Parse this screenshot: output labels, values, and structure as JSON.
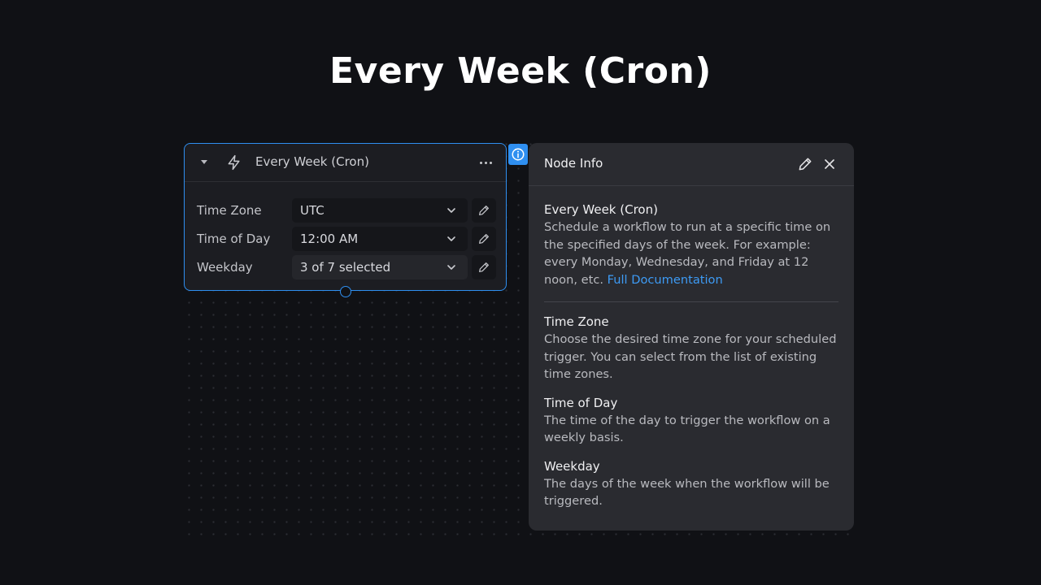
{
  "page": {
    "title": "Every Week (Cron)"
  },
  "node": {
    "title": "Every Week (Cron)",
    "fields": [
      {
        "label": "Time Zone",
        "value": "UTC"
      },
      {
        "label": "Time of Day",
        "value": "12:00 AM"
      },
      {
        "label": "Weekday",
        "value": "3 of 7 selected"
      }
    ]
  },
  "panel": {
    "title": "Node Info",
    "intro": {
      "heading": "Every Week (Cron)",
      "text": "Schedule a workflow to run at a specific time on the specified days of the week. For example: every Monday, Wednesday, and Friday at 12 noon, etc.",
      "link": "Full Documentation"
    },
    "sections": [
      {
        "heading": "Time Zone",
        "text": "Choose the desired time zone for your scheduled trigger. You can select from the list of existing time zones."
      },
      {
        "heading": "Time of Day",
        "text": "The time of the day to trigger the workflow on a weekly basis."
      },
      {
        "heading": "Weekday",
        "text": "The days of the week when the workflow will be triggered."
      }
    ]
  },
  "icons": {
    "collapse": "caret-down-icon",
    "trigger": "lightning-bolt-icon",
    "menu": "more-horizontal-icon",
    "edit": "pencil-icon",
    "dropdown": "chevron-down-icon",
    "info": "info-icon",
    "close": "close-icon"
  },
  "colors": {
    "accent": "#2f8ff0",
    "background": "#101115",
    "node_bg": "#1c1d22",
    "panel_bg": "#2a2b30",
    "link": "#3d9bf5"
  }
}
